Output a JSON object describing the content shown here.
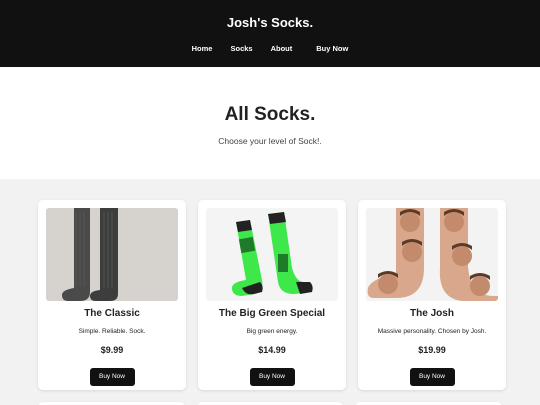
{
  "header": {
    "brand": "Josh's Socks.",
    "nav": [
      {
        "label": "Home"
      },
      {
        "label": "Socks"
      },
      {
        "label": "About"
      },
      {
        "label": "Buy Now"
      }
    ]
  },
  "hero": {
    "title": "All Socks.",
    "subtitle": "Choose your level of Sock!."
  },
  "products": [
    {
      "name": "The Classic",
      "description": "Simple. Reliable. Sock.",
      "price": "$9.99",
      "button": "Buy Now",
      "image": "grey-wool-socks"
    },
    {
      "name": "The Big Green Special",
      "description": "Big green energy.",
      "price": "$14.99",
      "button": "Buy Now",
      "image": "green-graphic-socks"
    },
    {
      "name": "The Josh",
      "description": "Massive personality. Chosen by Josh.",
      "price": "$19.99",
      "button": "Buy Now",
      "image": "face-print-socks"
    }
  ],
  "colors": {
    "header_bg": "#111111",
    "button_bg": "#111111",
    "page_bg": "#f2f2f2",
    "sock_green": "#3ee84a"
  }
}
